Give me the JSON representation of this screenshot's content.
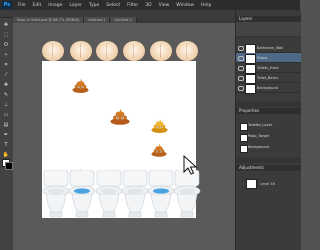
{
  "app": {
    "logo": "Ps"
  },
  "menu": [
    "File",
    "Edit",
    "Image",
    "Layer",
    "Type",
    "Select",
    "Filter",
    "3D",
    "View",
    "Window",
    "Help"
  ],
  "tabs": [
    "Poop in Toilet.psd @ 66.7% (RGB/8)",
    "Untitled-1",
    "Untitled-2"
  ],
  "panels": {
    "layers_title": "Layers",
    "layers": [
      {
        "name": "Bathroom_Wall",
        "selected": false
      },
      {
        "name": "Poops",
        "selected": true
      },
      {
        "name": "Toilets_Front",
        "selected": false
      },
      {
        "name": "Toilet_Backs",
        "selected": false
      },
      {
        "name": "Background",
        "selected": false
      }
    ],
    "properties_title": "Properties",
    "properties": [
      "Toilette_Layer",
      "Poop_Target",
      "Background"
    ],
    "adjust_title": "Adjustments",
    "adjust_item": "Level 46"
  },
  "colors": {
    "accent": "#4f6a86",
    "poop": "#c46d1e",
    "poop_gold": "#e8a21d",
    "water": "#4aa3e0"
  }
}
